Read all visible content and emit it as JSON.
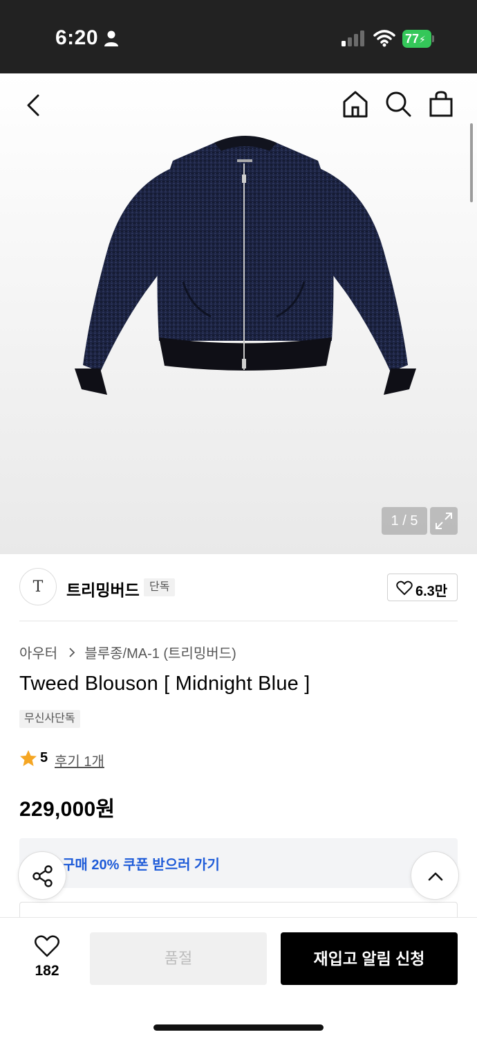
{
  "status_bar": {
    "time": "6:20",
    "battery": "77",
    "icons": [
      "person-icon",
      "signal-icon",
      "wifi-icon",
      "battery-charging-icon"
    ]
  },
  "top_nav": {
    "icons": [
      "back-icon",
      "home-icon",
      "search-icon",
      "shopping-bag-icon"
    ]
  },
  "gallery": {
    "counter": "1 / 5",
    "expand_icon": "expand-icon",
    "image": "navy tweed bomber jacket"
  },
  "brand": {
    "logo": "T",
    "name": "트리밍버드",
    "badge": "단독",
    "likes": "6.3만"
  },
  "product": {
    "category": "아우터",
    "subcategory": "블루종/MA-1 (트리밍버드)",
    "title": "Tweed Blouson [ Midnight Blue ]",
    "exclusive_badge": "무신사단독",
    "rating": "5",
    "review_link": "후기 1개",
    "price": "229,000원"
  },
  "coupon": {
    "text": "구매 20% 쿠폰 받으러 가기",
    "color": "#1e5bd8"
  },
  "bottom_bar": {
    "wish_count": "182",
    "soldout_label": "품절",
    "restock_label": "재입고 알림 신청"
  },
  "colors": {
    "status_bar_bg": "#222222",
    "accent_blue": "#1e5bd8",
    "battery_green": "#34c759",
    "star": "#f5a623"
  }
}
